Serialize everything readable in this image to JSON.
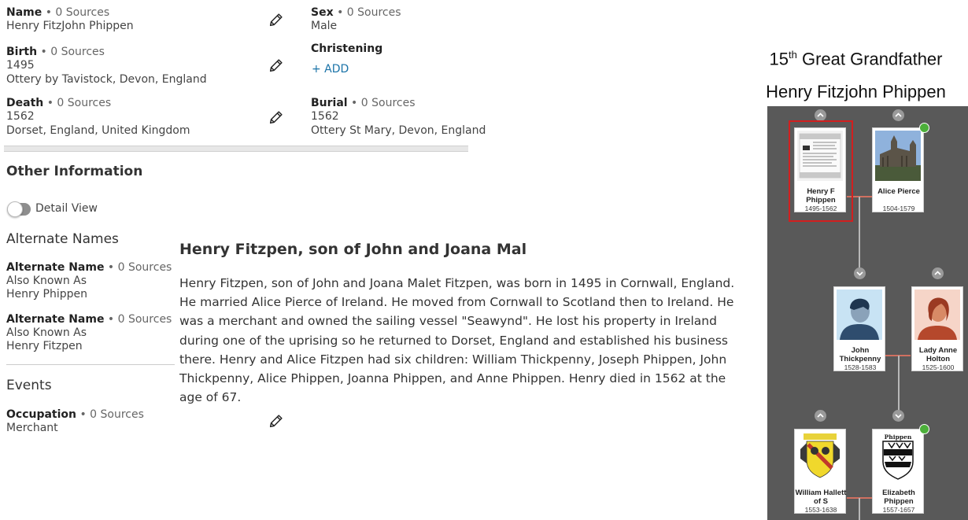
{
  "facts": {
    "name": {
      "label": "Name",
      "sources": "• 0 Sources",
      "lines": [
        "Henry FitzJohn Phippen"
      ]
    },
    "sex": {
      "label": "Sex",
      "sources": "• 0 Sources",
      "lines": [
        "Male"
      ]
    },
    "birth": {
      "label": "Birth",
      "sources": "• 0 Sources",
      "lines": [
        "1495",
        "Ottery by Tavistock, Devon, England"
      ]
    },
    "christening": {
      "label": "Christening",
      "add_label": "+ ADD"
    },
    "death": {
      "label": "Death",
      "sources": "• 0 Sources",
      "lines": [
        "1562",
        "Dorset, England, United Kingdom"
      ]
    },
    "burial": {
      "label": "Burial",
      "sources": "• 0 Sources",
      "lines": [
        "1562",
        "Ottery St Mary, Devon, England"
      ]
    }
  },
  "other_info": {
    "heading": "Other Information",
    "detail_view_label": "Detail View",
    "detail_view_on": false
  },
  "alternate_names": {
    "heading": "Alternate Names",
    "items": [
      {
        "label": "Alternate Name",
        "sources": "• 0 Sources",
        "type": "Also Known As",
        "value": "Henry Phippen"
      },
      {
        "label": "Alternate Name",
        "sources": "• 0 Sources",
        "type": "Also Known As",
        "value": "Henry Fitzpen"
      }
    ]
  },
  "events": {
    "heading": "Events",
    "items": [
      {
        "label": "Occupation",
        "sources": "• 0 Sources",
        "value": "Merchant"
      }
    ]
  },
  "story": {
    "title": "Henry Fitzpen, son of John and Joana Mal",
    "body": "Henry Fitzpen, son of John and Joana Malet Fitzpen, was born in 1495 in Cornwall, England. He married Alice Pierce of Ireland. He moved from Cornwall to Scotland then to Ireland. He was a merchant and owned the sailing vessel \"Seawynd\". He lost his property in Ireland during one of the uprising so he returned to Dorset, England and established his business there. Henry and Alice Fitzpen had six children: William Thickpenny, Joseph Phippen, John Thickpenny, Alice Phippen, Joanna Phippen, and Anne Phippen. Henry died in 1562 at the age of 67."
  },
  "relationship": {
    "ordinal": "15",
    "ordinal_suffix": "th",
    "title": "Great Grandfather",
    "person": "Henry Fitzjohn Phippen"
  },
  "tree": {
    "colors": {
      "background": "#595959",
      "selected": "#d21f1f",
      "hint": "#4caf3a"
    },
    "people": [
      {
        "name": "Henry F Phippen",
        "dates": "1495-1562",
        "photo": "document",
        "selected": true
      },
      {
        "name": "Alice Pierce",
        "dates": "1504-1579",
        "photo": "church",
        "hint": true
      },
      {
        "name": "John Thickpenny",
        "dates": "1528-1583",
        "photo": "male-silhouette"
      },
      {
        "name": "Lady Anne Holton",
        "dates": "1525-1600",
        "photo": "female-silhouette"
      },
      {
        "name": "William Hallett of S",
        "dates": "1553-1638",
        "photo": "coat-of-arms"
      },
      {
        "name": "Elizabeth Phippen",
        "dates": "1557-1657",
        "photo": "shield",
        "hint": true,
        "photo_caption": "Phippen"
      }
    ]
  }
}
